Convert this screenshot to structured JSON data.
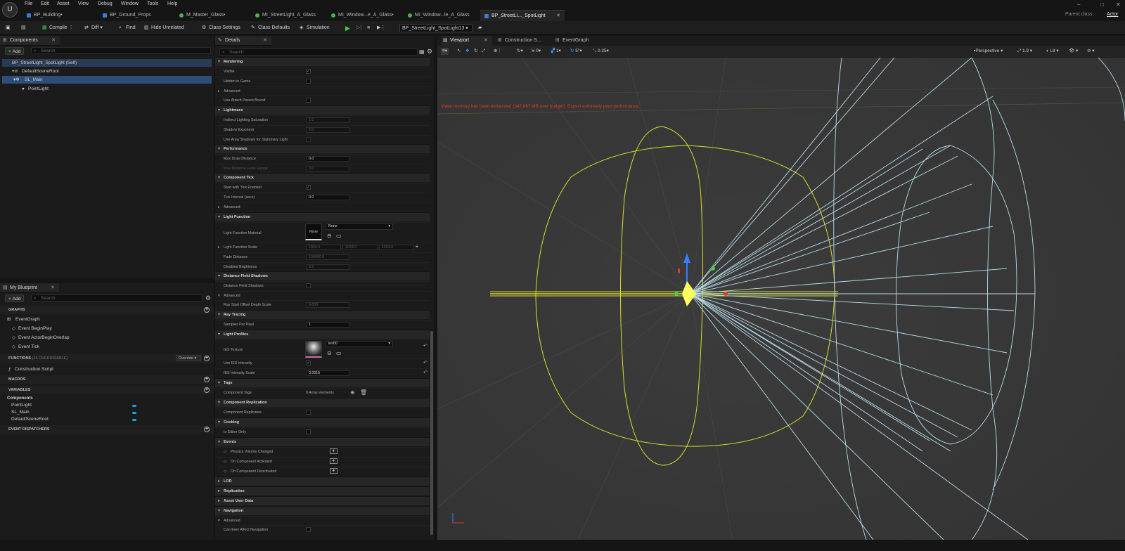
{
  "app": {
    "logo": "U"
  },
  "menu": [
    "File",
    "Edit",
    "Asset",
    "View",
    "Debug",
    "Window",
    "Tools",
    "Help"
  ],
  "tabs": [
    {
      "label": "BP_Building•",
      "color": "#3a7bd5"
    },
    {
      "label": "BP_Ground_Props",
      "color": "#3a7bd5"
    },
    {
      "label": "M_Master_Glass•",
      "color": "#4caf50"
    },
    {
      "label": "MI_StreetLight_A_Glass",
      "color": "#4caf50"
    },
    {
      "label": "MI_Window...e_A_Glass•",
      "color": "#4caf50"
    },
    {
      "label": "MI_Window...le_A_Glass",
      "color": "#4caf50"
    },
    {
      "label": "BP_StreetLi..._SpotLight",
      "color": "#3a7bd5"
    }
  ],
  "window_controls": {
    "minimize": "–",
    "maximize": "□",
    "close": "✕"
  },
  "parent_class": {
    "label": "Parent class:",
    "value": "Actor"
  },
  "toolbar": {
    "compile": "Compile",
    "diff": "Diff",
    "find": "Find",
    "hide_unrelated": "Hide Unrelated",
    "class_settings": "Class Settings",
    "class_defaults": "Class Defaults",
    "simulation": "Simulation",
    "debug_object": "BP_StreetLight_SpotLight13"
  },
  "components": {
    "title": "Components",
    "add": "Add",
    "search_placeholder": "Search",
    "items": [
      "BP_StreetLight_SpotLight (Self)",
      "DefaultSceneRoot",
      "SL_Main",
      "PointLight"
    ]
  },
  "my_blueprint": {
    "title": "My Blueprint",
    "add": "Add",
    "search_placeholder": "Search",
    "graphs_label": "GRAPHS",
    "event_graph": "EventGraph",
    "events": [
      "Event BeginPlay",
      "Event ActorBeginOverlap",
      "Event Tick"
    ],
    "functions_label": "FUNCTIONS",
    "functions_count": "(15 OVERRIDABLE)",
    "override": "Override",
    "construction_script": "Construction Script",
    "macros_label": "MACROS",
    "variables_label": "VARIABLES",
    "components_label": "Components",
    "variables": [
      "PointLight",
      "SL_Main",
      "DefaultSceneRoot"
    ],
    "dispatchers_label": "EVENT DISPATCHERS"
  },
  "details": {
    "title": "Details",
    "search_placeholder": "Search",
    "rendering": "Rendering",
    "visible": "Visible",
    "hidden_in_game": "Hidden in Game",
    "advanced": "Advanced",
    "use_attach_parent_bound": "Use Attach Parent Bound",
    "lightmass": "Lightmass",
    "indirect_lighting_saturation": "Indirect Lighting Saturation",
    "ils_value": "1.0",
    "shadow_exponent": "Shadow Exponent",
    "se_value": "2.0",
    "use_area_shadows": "Use Area Shadows for Stationary Light",
    "performance": "Performance",
    "max_draw_distance": "Max Draw Distance",
    "mdd_value": "0.0",
    "max_distance_fade_range": "Max Distance Fade Range",
    "mdfr_value": "0.0",
    "component_tick": "Component Tick",
    "start_with_tick": "Start with Tick Enabled",
    "tick_interval": "Tick Interval (secs)",
    "ti_value": "0.0",
    "light_function": "Light Function",
    "light_function_material": "Light Function Material",
    "none": "None",
    "none_dropdown": "None",
    "light_function_scale": "Light Function Scale",
    "lfs_x": "1024.0",
    "lfs_y": "1024.0",
    "lfs_z": "1024.0",
    "fade_distance": "Fade Distance",
    "fd_value": "100000.0",
    "disabled_brightness": "Disabled Brightness",
    "db_value": "0.5",
    "distance_field_shadows": "Distance Field Shadows",
    "dfs_prop": "Distance Field Shadows",
    "ray_start_offset": "Ray Start Offset Depth Scale",
    "rso_value": "0.003",
    "ray_tracing": "Ray Tracing",
    "samples_per_pixel": "Samples Per Pixel",
    "spp_value": "1",
    "light_profiles": "Light Profiles",
    "ies_texture": "IES Texture",
    "ies_texture_value": "ies00",
    "use_ies_intensity": "Use IES Intensity",
    "ies_intensity_scale": "IES Intensity Scale",
    "iis_value": "0.0015",
    "tags": "Tags",
    "component_tags": "Component Tags",
    "array_elements": "0 Array elements",
    "component_replication": "Component Replication",
    "component_replicates": "Component Replicates",
    "cooking": "Cooking",
    "is_editor_only": "Is Editor Only",
    "events": "Events",
    "physics_volume_changed": "Physics Volume Changed",
    "on_component_activated": "On Component Activated",
    "on_component_deactivated": "On Component Deactivated",
    "lod": "LOD",
    "replication": "Replication",
    "asset_user_data": "Asset User Data",
    "navigation": "Navigation",
    "can_ever_affect_navigation": "Can Ever Affect Navigation"
  },
  "viewport": {
    "tabs": [
      "Viewport",
      "Construction S...",
      "EventGraph"
    ],
    "snap_rot": "0",
    "snap_grid": "1",
    "snap_angle": "5°",
    "snap_scale": "0.25",
    "perspective": "Perspective",
    "fov": "1.9",
    "lit": "Lit",
    "warning": "Video memory has been exhausted (347.667 MB over budget). Expect extremely poor performance."
  },
  "colors": {
    "accent": "#3ea0ff",
    "green": "#3fd04a",
    "warn": "#e03a2a",
    "sphere": "#d8df2a",
    "cone": "#b8dcea"
  }
}
